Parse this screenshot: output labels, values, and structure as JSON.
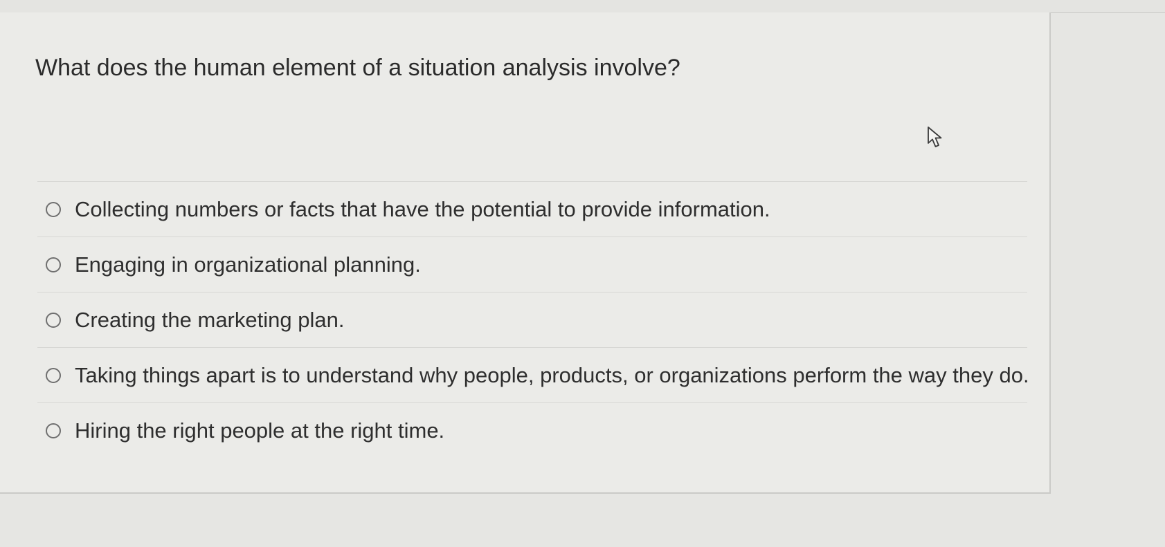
{
  "question": {
    "text": "What does the human element of a situation analysis involve?"
  },
  "options": [
    {
      "label": "Collecting numbers or facts that have the potential to provide information.",
      "selected": false
    },
    {
      "label": "Engaging in organizational planning.",
      "selected": false
    },
    {
      "label": "Creating the marketing plan.",
      "selected": false
    },
    {
      "label": "Taking things apart is to understand why people, products, or organizations perform the way they do.",
      "selected": false
    },
    {
      "label": "Hiring the right people at the right time.",
      "selected": false
    }
  ],
  "icons": {
    "radio": "radio-unselected-icon",
    "cursor": "mouse-pointer-icon"
  }
}
